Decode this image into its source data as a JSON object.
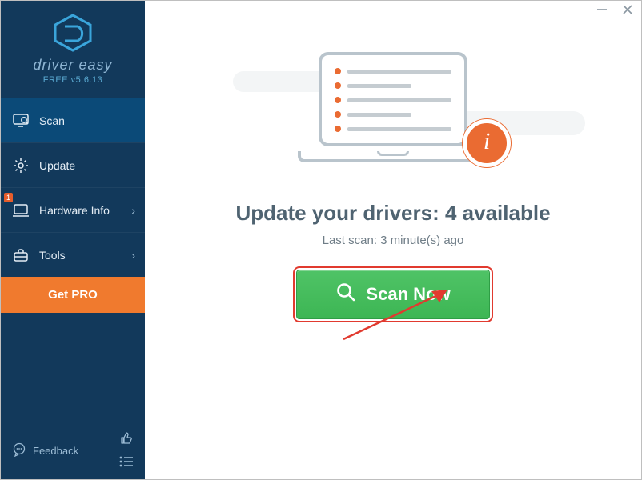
{
  "brand": {
    "name": "driver easy",
    "version_prefix": "FREE ",
    "version": "v5.6.13"
  },
  "sidebar": {
    "items": [
      {
        "label": "Scan",
        "icon": "scan-icon",
        "active": true
      },
      {
        "label": "Update",
        "icon": "gear-icon"
      },
      {
        "label": "Hardware Info",
        "icon": "laptop-icon",
        "chevron": true,
        "badge": "1"
      },
      {
        "label": "Tools",
        "icon": "toolbox-icon",
        "chevron": true
      }
    ],
    "get_pro_label": "Get PRO",
    "feedback_label": "Feedback"
  },
  "main": {
    "headline_prefix": "Update your drivers: ",
    "available_count": 4,
    "headline_suffix": " available",
    "last_scan_label": "Last scan: 3 minute(s) ago",
    "scan_button_label": "Scan Now",
    "info_glyph": "i"
  },
  "colors": {
    "sidebar_bg": "#12395b",
    "sidebar_active": "#0b4a78",
    "accent_orange": "#f07a2e",
    "scan_green": "#3db654",
    "highlight_red": "#e13a2f"
  }
}
